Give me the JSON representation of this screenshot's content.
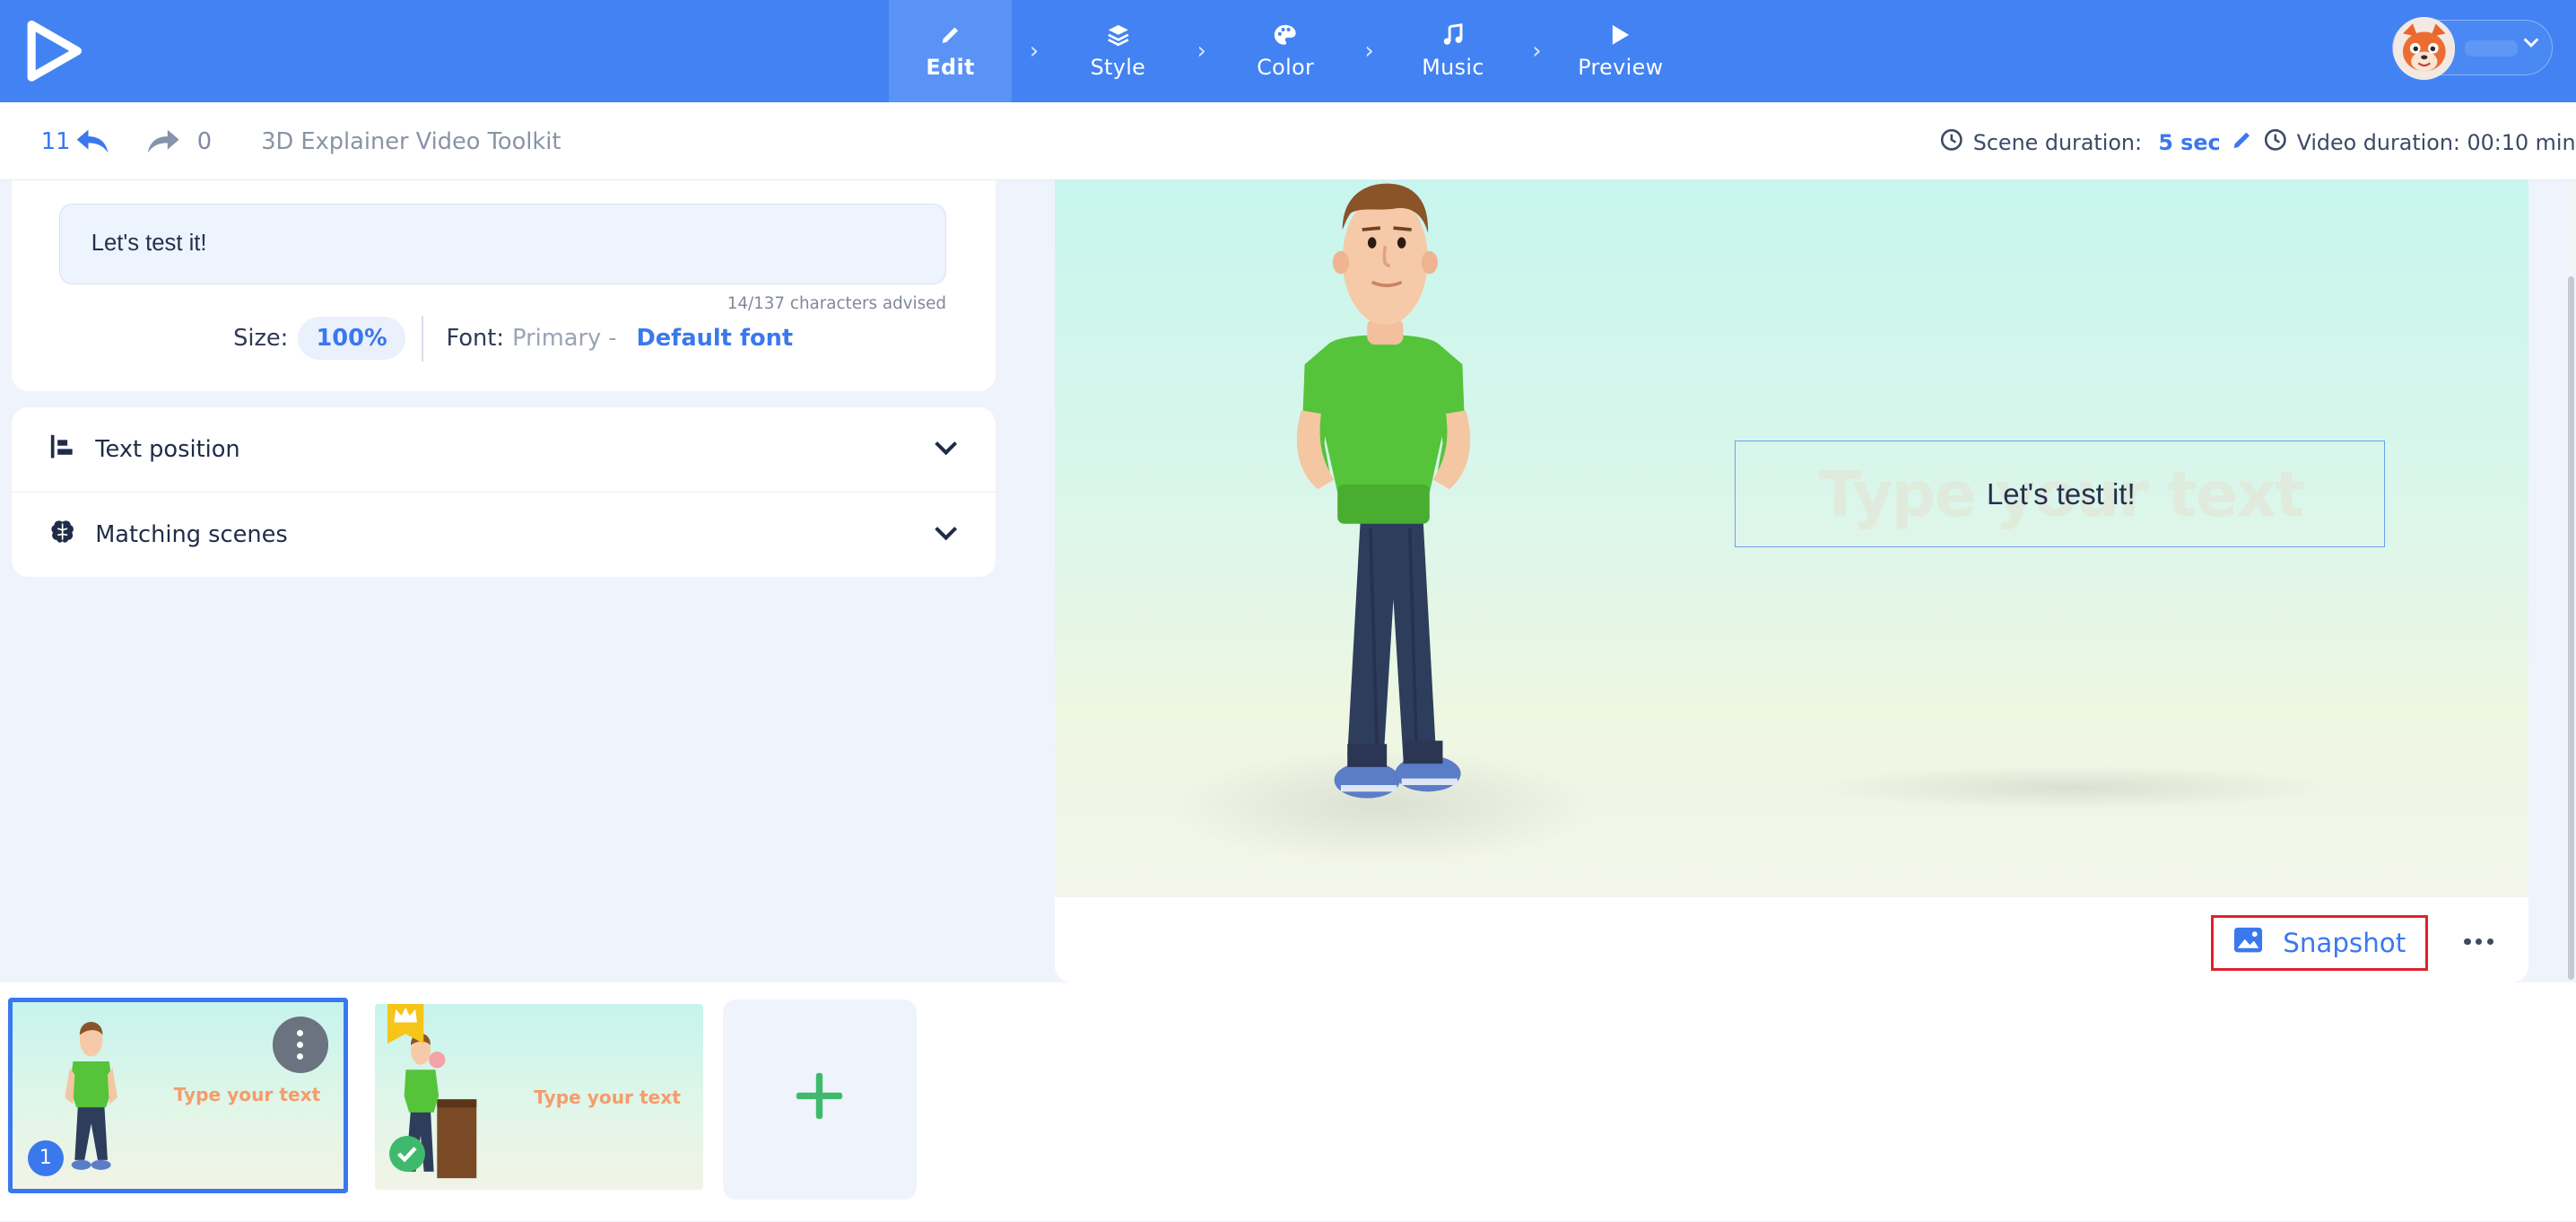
{
  "nav": {
    "steps": [
      {
        "label": "Edit",
        "icon": "pencil-icon",
        "active": true
      },
      {
        "label": "Style",
        "icon": "layers-icon",
        "active": false
      },
      {
        "label": "Color",
        "icon": "palette-icon",
        "active": false
      },
      {
        "label": "Music",
        "icon": "music-note-icon",
        "active": false
      },
      {
        "label": "Preview",
        "icon": "play-icon",
        "active": false
      }
    ]
  },
  "toolbar": {
    "undo_count": "11",
    "redo_count": "0",
    "project_title": "3D Explainer Video Toolkit",
    "scene_duration_label": "Scene duration:",
    "scene_duration_value": "5 sec",
    "video_duration": "Video duration: 00:10 min"
  },
  "text_panel": {
    "input_value": "Let's test it!",
    "char_count": "14/137 characters advised",
    "size_label": "Size:",
    "size_value": "100%",
    "font_label": "Font:",
    "font_category": "Primary -",
    "font_name": "Default font"
  },
  "accordion": {
    "items": [
      {
        "label": "Text position",
        "icon": "align-left-icon"
      },
      {
        "label": "Matching scenes",
        "icon": "brain-icon"
      }
    ]
  },
  "preview": {
    "placeholder_text": "Type your text",
    "text": "Let's test it!",
    "snapshot_label": "Snapshot"
  },
  "scenes": {
    "items": [
      {
        "number": "1",
        "text": "Type your text"
      },
      {
        "text": "Type your text"
      }
    ]
  },
  "colors": {
    "brand": "#4382f2",
    "accent": "#3a78ee",
    "highlight": "#e0212d",
    "success": "#3fba6c"
  }
}
